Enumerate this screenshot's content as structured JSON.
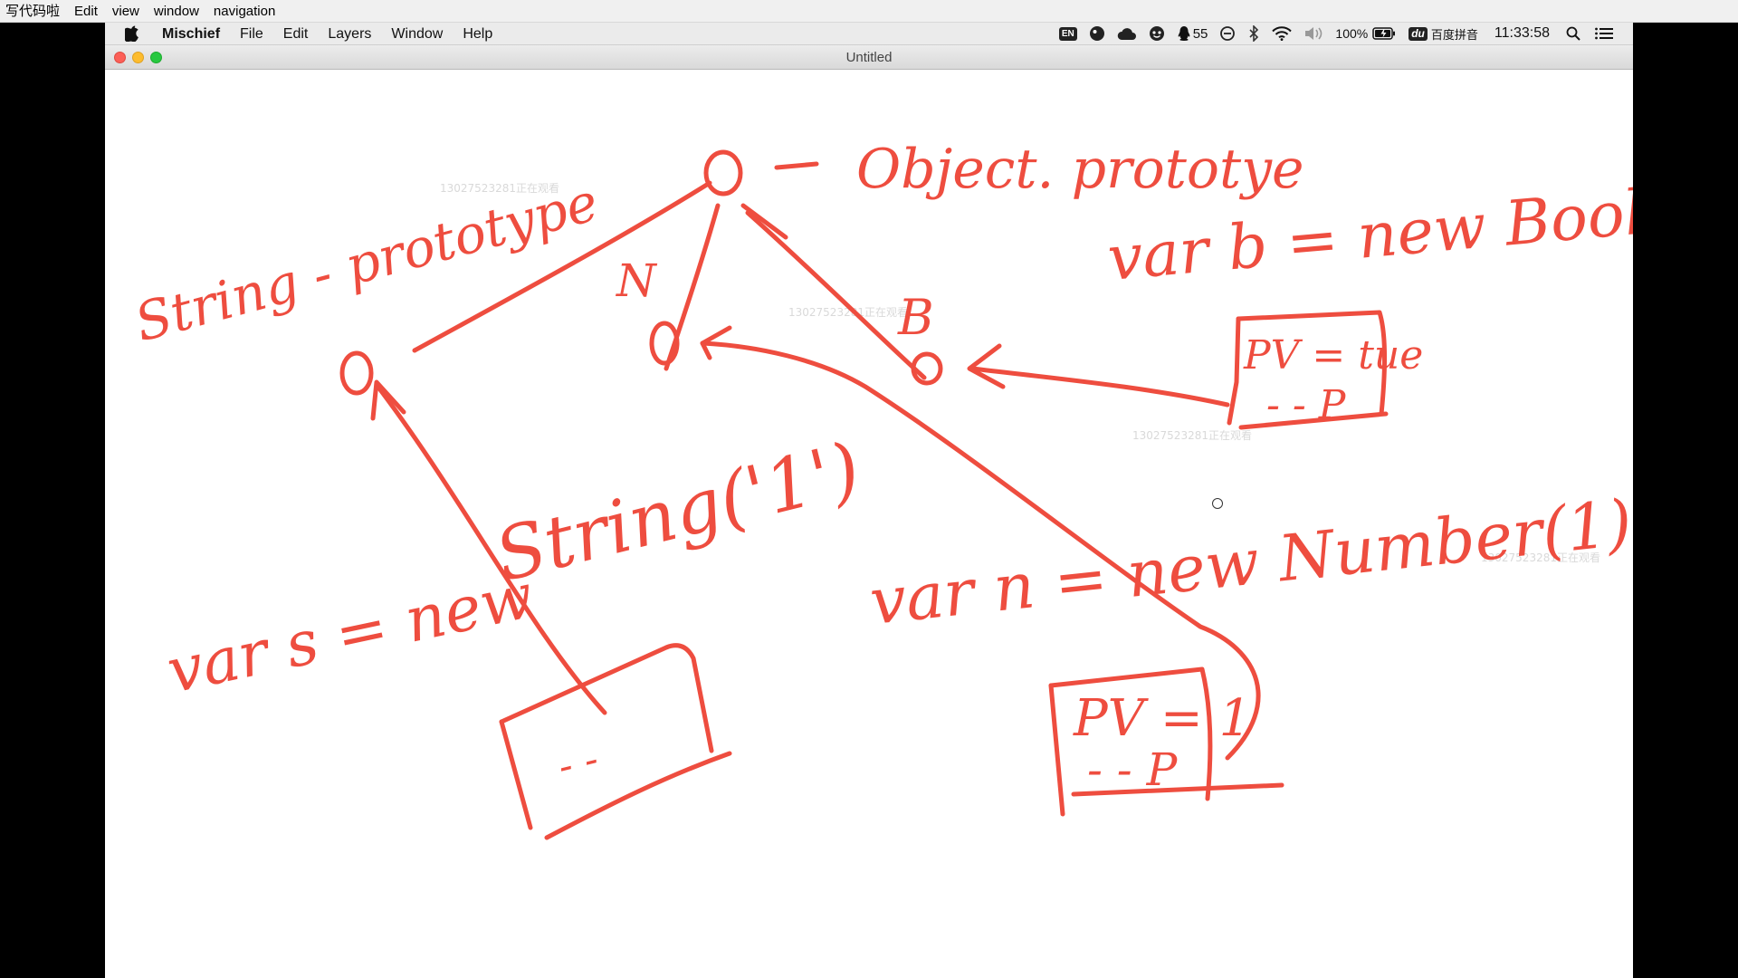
{
  "host_menubar": {
    "items": [
      "写代码啦",
      "Edit",
      "view",
      "window",
      "navigation"
    ]
  },
  "mac_menubar": {
    "app_name": "Mischief",
    "menus": [
      "File",
      "Edit",
      "Layers",
      "Window",
      "Help"
    ],
    "status": {
      "input_badge": "EN",
      "qq_count": "55",
      "battery": "100%",
      "ime_badge": "du",
      "ime_name": "百度拼音",
      "clock": "11:33:58"
    }
  },
  "window": {
    "title": "Untitled"
  },
  "drawing": {
    "ink_color": "#ee4d3f",
    "labels": {
      "object_proto": "Object. prototye",
      "string_proto": "String - prototype",
      "n_node": "N",
      "b_node": "B",
      "var_b": "var b = new Bool(true)",
      "pv_true": "PV = tue",
      "p_b": "- - P",
      "var_s": "var s = new",
      "string_call": "String('1')",
      "var_n": "var n = new Number(1)",
      "pv_one": "PV = 1",
      "p_n": "- - P",
      "p_s": "- -"
    },
    "watermark": "13027523281正在观看"
  }
}
